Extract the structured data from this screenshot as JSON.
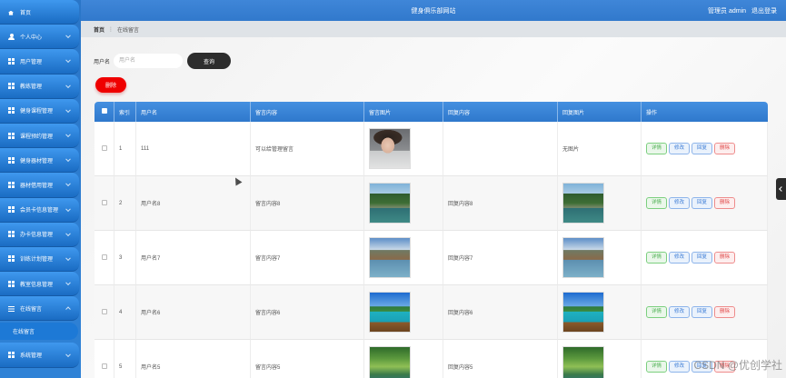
{
  "header": {
    "title": "健身俱乐部网站",
    "user_label": "管理员 admin",
    "logout_label": "退出登录"
  },
  "sidebar": {
    "items": [
      {
        "label": "首页",
        "icon": "home-icon",
        "expandable": false
      },
      {
        "label": "个人中心",
        "icon": "user-icon",
        "expandable": true
      },
      {
        "label": "用户管理",
        "icon": "grid-icon",
        "expandable": true
      },
      {
        "label": "教练管理",
        "icon": "grid-icon",
        "expandable": true
      },
      {
        "label": "健身课程管理",
        "icon": "grid-icon",
        "expandable": true
      },
      {
        "label": "课程预约管理",
        "icon": "grid-icon",
        "expandable": true
      },
      {
        "label": "健身器材管理",
        "icon": "grid-icon",
        "expandable": true
      },
      {
        "label": "器材借用管理",
        "icon": "grid-icon",
        "expandable": true
      },
      {
        "label": "会员卡信息管理",
        "icon": "grid-icon",
        "expandable": true
      },
      {
        "label": "办卡信息管理",
        "icon": "grid-icon",
        "expandable": true
      },
      {
        "label": "训练计划管理",
        "icon": "grid-icon",
        "expandable": true
      },
      {
        "label": "教室信息管理",
        "icon": "grid-icon",
        "expandable": true
      },
      {
        "label": "在线留言",
        "icon": "list-icon",
        "expandable": true,
        "expanded": true
      },
      {
        "label": "系统管理",
        "icon": "grid-icon",
        "expandable": true
      }
    ],
    "sub_item": "在线留言"
  },
  "breadcrumb": {
    "home": "首页",
    "current": "在线留言"
  },
  "search": {
    "label": "用户名",
    "placeholder": "用户名",
    "button": "查询"
  },
  "delete_button": "删除",
  "table": {
    "headers": [
      "索引",
      "用户名",
      "留言内容",
      "留言图片",
      "回复内容",
      "回复图片",
      "操作"
    ],
    "rows": [
      {
        "index": "1",
        "username": "111",
        "content": "可以给管理留言",
        "image": "portrait",
        "reply": "",
        "reply_image": "",
        "reply_image_text": "无图片"
      },
      {
        "index": "2",
        "username": "用户名8",
        "content": "留言内容8",
        "image": "lake1",
        "reply": "回复内容8",
        "reply_image": "lake1",
        "reply_image_text": ""
      },
      {
        "index": "3",
        "username": "用户名7",
        "content": "留言内容7",
        "image": "lake2",
        "reply": "回复内容7",
        "reply_image": "lake2",
        "reply_image_text": ""
      },
      {
        "index": "4",
        "username": "用户名6",
        "content": "留言内容6",
        "image": "beach",
        "reply": "回复内容6",
        "reply_image": "beach",
        "reply_image_text": ""
      },
      {
        "index": "5",
        "username": "用户名5",
        "content": "留言内容5",
        "image": "forest",
        "reply": "回复内容5",
        "reply_image": "forest",
        "reply_image_text": ""
      }
    ],
    "actions": {
      "detail": "详情",
      "edit": "修改",
      "reply": "回复",
      "delete": "删除"
    }
  },
  "watermark": "CSDN @优创学社"
}
